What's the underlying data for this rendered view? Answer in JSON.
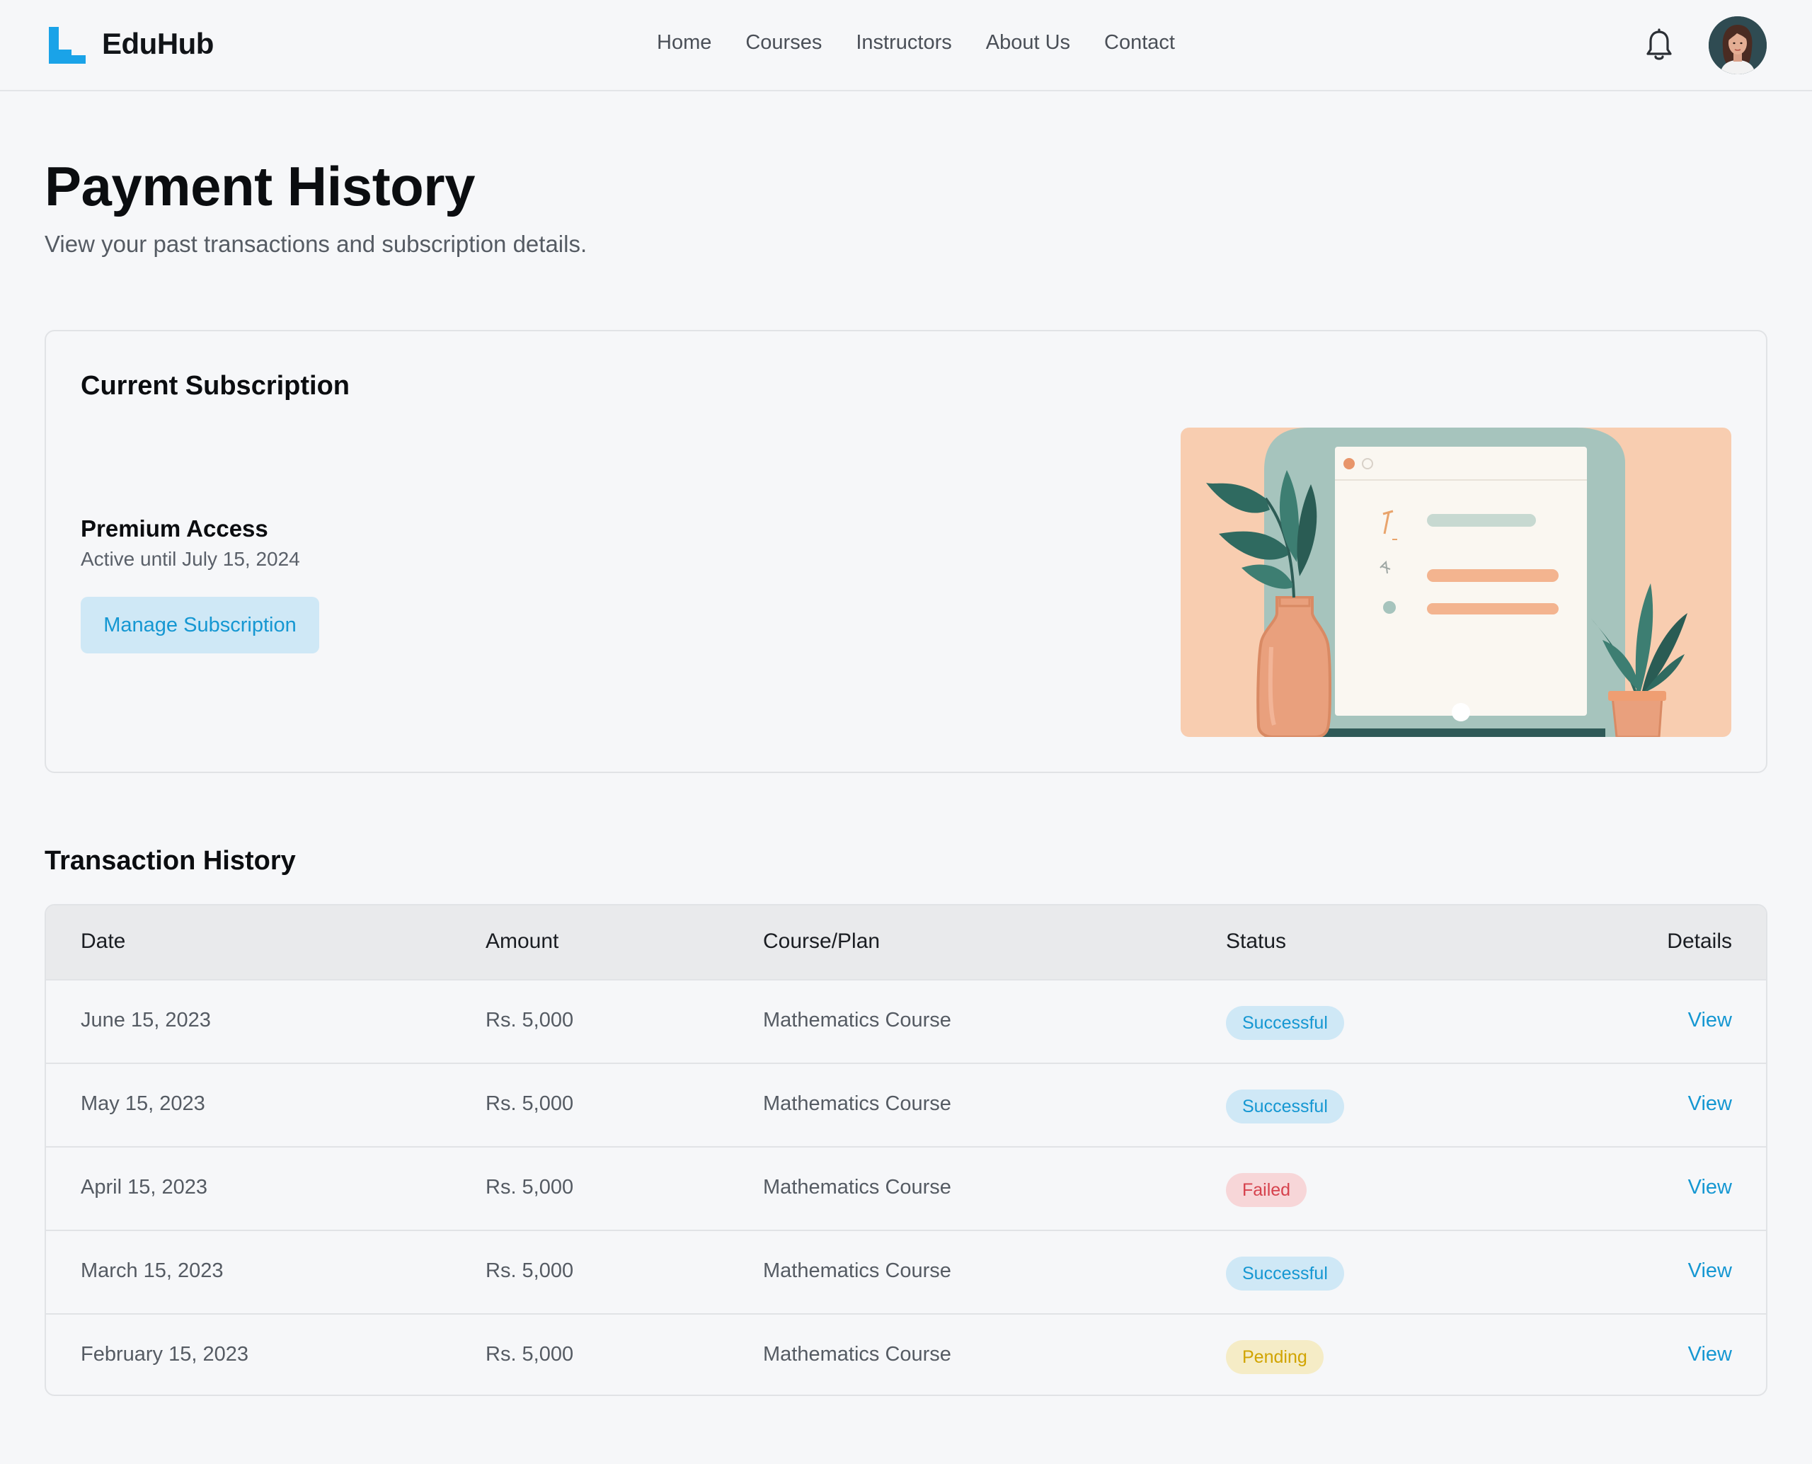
{
  "header": {
    "brand": "EduHub",
    "nav": [
      "Home",
      "Courses",
      "Instructors",
      "About Us",
      "Contact"
    ]
  },
  "page": {
    "title": "Payment History",
    "subtitle": "View your past transactions and subscription details."
  },
  "subscription": {
    "heading": "Current Subscription",
    "plan": "Premium Access",
    "expiry": "Active until July 15, 2024",
    "manage_label": "Manage Subscription"
  },
  "transactions": {
    "heading": "Transaction History",
    "columns": [
      "Date",
      "Amount",
      "Course/Plan",
      "Status",
      "Details"
    ],
    "rows": [
      {
        "date": "June 15, 2023",
        "amount": "Rs. 5,000",
        "course": "Mathematics Course",
        "status": "Successful",
        "status_kind": "success",
        "details": "View"
      },
      {
        "date": "May 15, 2023",
        "amount": "Rs. 5,000",
        "course": "Mathematics Course",
        "status": "Successful",
        "status_kind": "success",
        "details": "View"
      },
      {
        "date": "April 15, 2023",
        "amount": "Rs. 5,000",
        "course": "Mathematics Course",
        "status": "Failed",
        "status_kind": "failed",
        "details": "View"
      },
      {
        "date": "March 15, 2023",
        "amount": "Rs. 5,000",
        "course": "Mathematics Course",
        "status": "Successful",
        "status_kind": "success",
        "details": "View"
      },
      {
        "date": "February 15, 2023",
        "amount": "Rs. 5,000",
        "course": "Mathematics Course",
        "status": "Pending",
        "status_kind": "pending",
        "details": "View"
      }
    ]
  },
  "colors": {
    "accent": "#1597d2",
    "success_bg": "#cfe8f6",
    "failed_bg": "#f7d6d8",
    "failed_text": "#d6424d",
    "pending_bg": "#f5ecc6",
    "pending_text": "#d1a400"
  },
  "icons": {
    "logo": "eduhub-logo-icon",
    "notifications": "bell-icon",
    "user": "user-avatar"
  }
}
